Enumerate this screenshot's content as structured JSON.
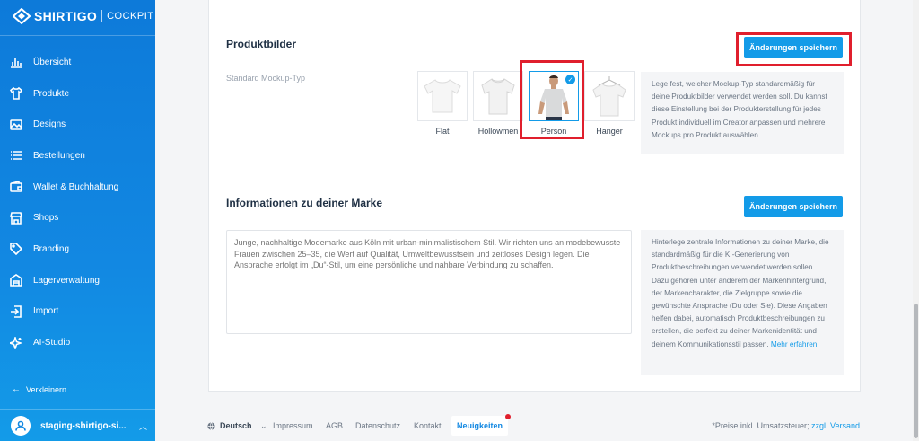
{
  "brand": {
    "name": "SHIRTIGO",
    "sub": "COCKPIT"
  },
  "sidebar": {
    "items": [
      {
        "label": "Übersicht",
        "icon": "chart-bars-icon"
      },
      {
        "label": "Produkte",
        "icon": "tshirt-icon"
      },
      {
        "label": "Designs",
        "icon": "image-icon"
      },
      {
        "label": "Bestellungen",
        "icon": "list-icon"
      },
      {
        "label": "Wallet & Buchhaltung",
        "icon": "wallet-icon"
      },
      {
        "label": "Shops",
        "icon": "shop-icon"
      },
      {
        "label": "Branding",
        "icon": "tag-icon"
      },
      {
        "label": "Lagerverwaltung",
        "icon": "warehouse-icon"
      },
      {
        "label": "Import",
        "icon": "import-icon"
      },
      {
        "label": "AI-Studio",
        "icon": "sparkle-icon"
      }
    ],
    "collapse_label": "Verkleinern",
    "account_name": "staging-shirtigo-si..."
  },
  "product_images": {
    "title": "Produktbilder",
    "save_label": "Änderungen speichern",
    "mockup_type_label": "Standard Mockup-Typ",
    "mockups": [
      {
        "label": "Flat"
      },
      {
        "label": "Hollowmen"
      },
      {
        "label": "Person",
        "selected": true
      },
      {
        "label": "Hanger"
      }
    ],
    "help": "Lege fest, welcher Mockup-Typ standardmäßig für deine Produktbilder verwendet werden soll. Du kannst diese Einstellung bei der Produkterstellung für jedes Produkt individuell im Creator anpassen und mehrere Mockups pro Produkt auswählen."
  },
  "brand_info": {
    "title": "Informationen zu deiner Marke",
    "save_label": "Änderungen speichern",
    "placeholder": "Junge, nachhaltige Modemarke aus Köln mit urban-minimalistischem Stil. Wir richten uns an modebewusste Frauen zwischen 25–35, die Wert auf Qualität, Umweltbewusstsein und zeitloses Design legen. Die Ansprache erfolgt im „Du“-Stil, um eine persönliche und nahbare Verbindung zu schaffen.",
    "help": "Hinterlege zentrale Informationen zu deiner Marke, die standardmäßig für die KI-Generierung von Produktbeschreibungen verwendet werden sollen. Dazu gehören unter anderem der Markenhintergrund, der Markencharakter, die Zielgruppe sowie die gewünschte Ansprache (Du oder Sie). Diese Angaben helfen dabei, automatisch Produktbeschreibungen zu erstellen, die perfekt zu deiner Markenidentität und deinem Kommunikationsstil passen.",
    "help_link": "Mehr erfahren"
  },
  "footer": {
    "language": "Deutsch",
    "links": [
      "Impressum",
      "AGB",
      "Datenschutz",
      "Kontakt"
    ],
    "news": "Neuigkeiten",
    "note": "*Preise inkl. Umsatzsteuer; ",
    "note_link": "zzgl. Versand"
  },
  "colors": {
    "accent": "#139be8",
    "sidebar": "#1288e2",
    "highlight": "#e01f2d"
  }
}
